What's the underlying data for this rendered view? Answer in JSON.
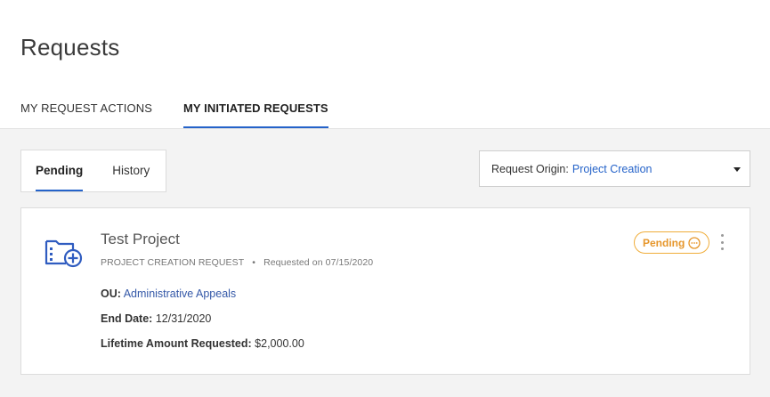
{
  "header": {
    "title": "Requests",
    "tabs": [
      {
        "label": "MY REQUEST ACTIONS",
        "active": false
      },
      {
        "label": "MY INITIATED REQUESTS",
        "active": true
      }
    ]
  },
  "subtabs": [
    {
      "label": "Pending",
      "active": true
    },
    {
      "label": "History",
      "active": false
    }
  ],
  "origin_filter": {
    "label": "Request Origin:",
    "value": "Project Creation"
  },
  "request": {
    "icon": "folder-add-icon",
    "title": "Test Project",
    "type": "PROJECT CREATION REQUEST",
    "separator": "•",
    "requested": "Requested on 07/15/2020",
    "ou_label": "OU:",
    "ou_value": "Administrative Appeals",
    "end_date_label": "End Date:",
    "end_date_value": "12/31/2020",
    "amount_label": "Lifetime Amount Requested:",
    "amount_value": "$2,000.00",
    "status": "Pending",
    "status_icon": "more-circle-icon"
  },
  "colors": {
    "accent": "#2563c9",
    "pending": "#f0ad3a",
    "link": "#3559a8"
  }
}
